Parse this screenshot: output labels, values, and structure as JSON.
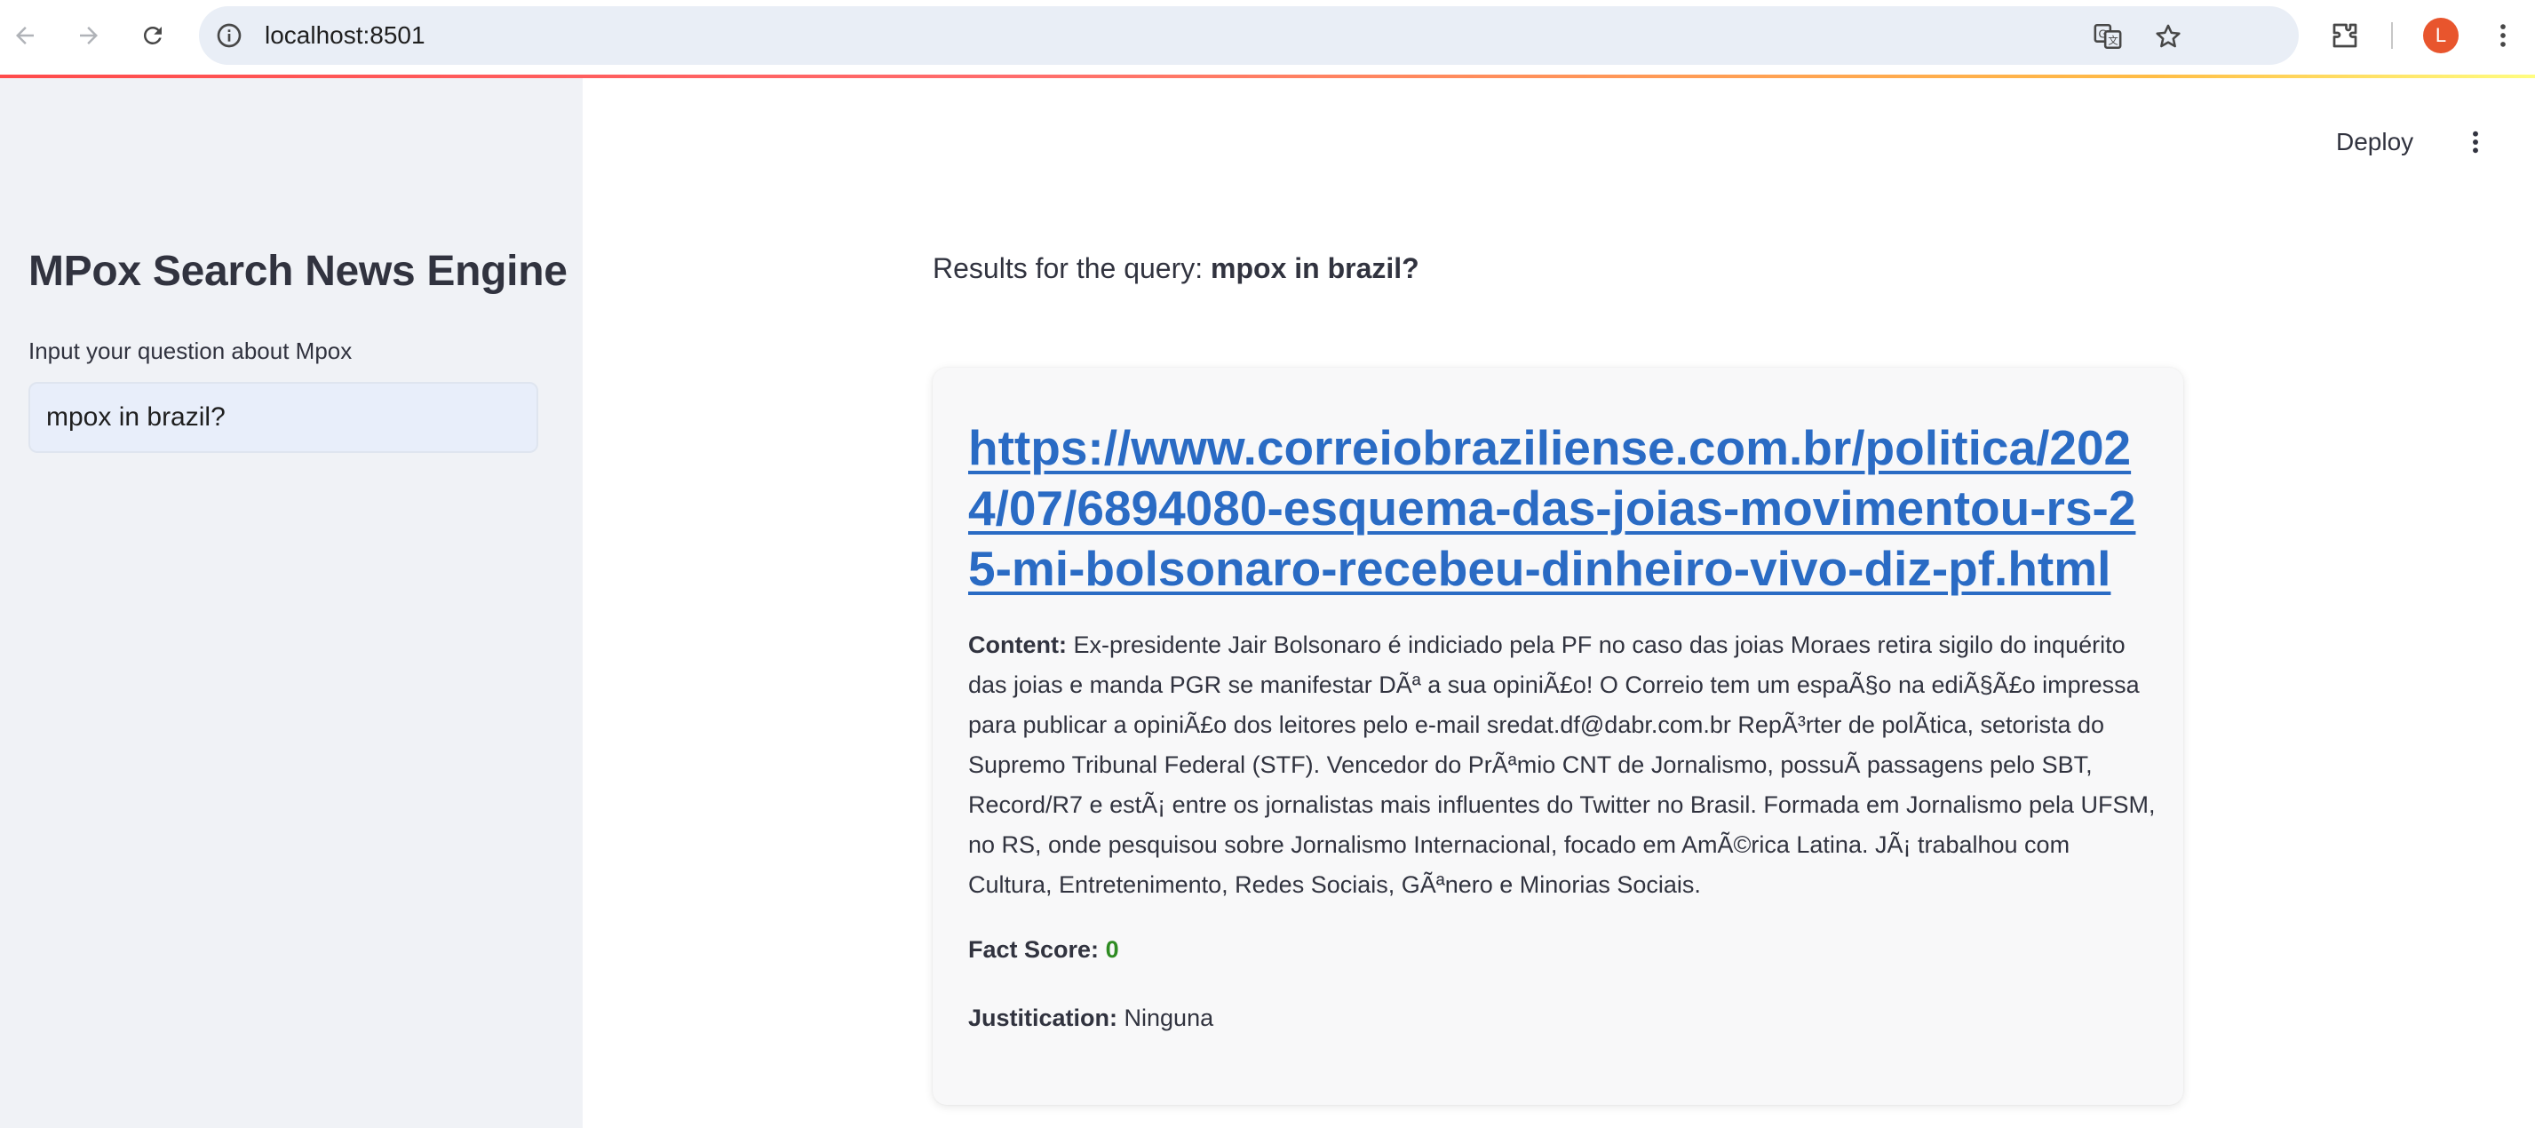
{
  "browser": {
    "url": "localhost:8501",
    "avatar_letter": "L"
  },
  "sidebar": {
    "title": "MPox Search News Engine",
    "input_label": "Input your question about Mpox",
    "input_value": "mpox in brazil?"
  },
  "header": {
    "deploy_label": "Deploy"
  },
  "main": {
    "query_prefix": "Results for the query: ",
    "query_text": "mpox in brazil?"
  },
  "result": {
    "url": "https://www.correiobraziliense.com.br/politica/2024/07/6894080-esquema-das-joias-movimentou-rs-25-mi-bolsonaro-recebeu-dinheiro-vivo-diz-pf.html",
    "content_label": "Content:",
    "content_text": " Ex-presidente Jair Bolsonaro é indiciado pela PF no caso das joias Moraes retira sigilo do inquérito das joias e manda PGR se manifestar DÃª a sua opiniÃ£o! O Correio tem um espaÃ§o na ediÃ§Ã£o impressa para publicar a opiniÃ£o dos leitores pelo e-mail sredat.df@dabr.com.br RepÃ³rter de polÃtica, setorista do Supremo Tribunal Federal (STF). Vencedor do PrÃªmio CNT de Jornalismo, possuÃ passagens pelo SBT, Record/R7 e estÃ¡ entre os jornalistas mais influentes do Twitter no Brasil. Formada em Jornalismo pela UFSM, no RS, onde pesquisou sobre Jornalismo Internacional, focado em AmÃ©rica Latina. JÃ¡ trabalhou com Cultura, Entretenimento, Redes Sociais, GÃªnero e Minorias Sociais.",
    "fact_label": "Fact Score:",
    "fact_value": "0",
    "justification_label": "Justitication:",
    "justification_value": " Ninguna"
  },
  "colors": {
    "link": "#2a6bc4",
    "fact_score": "#2e8b22",
    "avatar": "#e8552d",
    "sidebar_bg": "#f0f2f6"
  },
  "icons": [
    "back-arrow-icon",
    "forward-arrow-icon",
    "reload-icon",
    "site-info-icon",
    "translate-icon",
    "bookmark-star-icon",
    "extensions-icon",
    "chrome-menu-icon",
    "app-menu-icon"
  ]
}
